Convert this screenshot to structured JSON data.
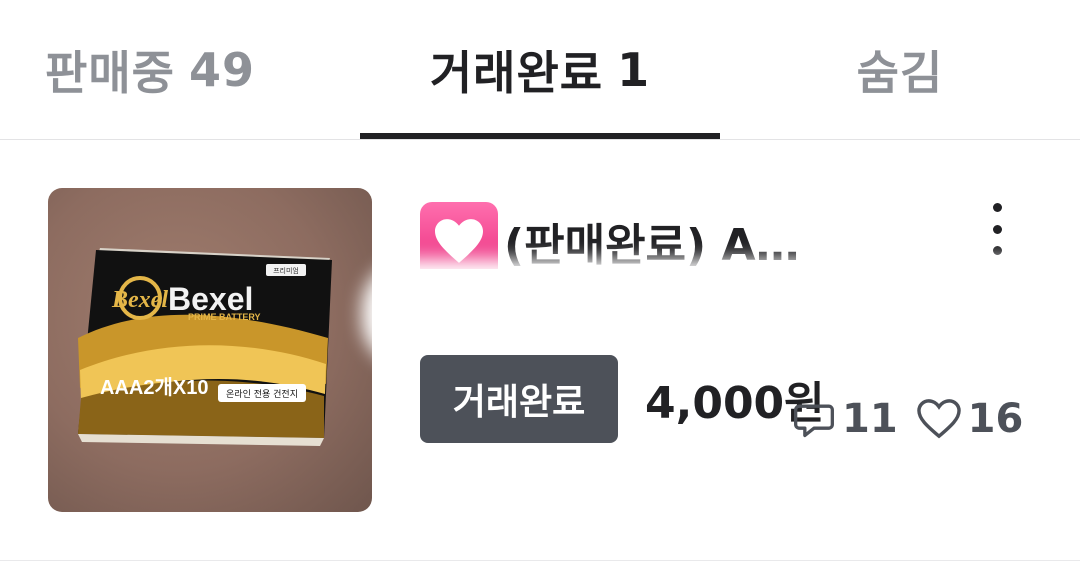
{
  "tabs": [
    {
      "label": "판매중",
      "count": "49",
      "active": false
    },
    {
      "label": "거래완료",
      "count": "1",
      "active": true
    },
    {
      "label": "숨김",
      "count": "",
      "active": false
    }
  ],
  "item": {
    "title": "(판매완료) A…",
    "title_emoji": "heart-decoration-emoji",
    "status_badge": "거래완료",
    "price": "4,000원",
    "chat_count": "11",
    "like_count": "16",
    "thumbnail": {
      "brand": "Bexel",
      "subtitle": "PRIME BATTERY",
      "spec": "AAA2개X10",
      "note": "온라인 전용 건전지",
      "tag": "프리미엄"
    }
  },
  "colors": {
    "active_text": "#212124",
    "inactive_text": "#8e9197",
    "badge_bg": "#4d5159",
    "heart_pink": "#e9287a"
  }
}
